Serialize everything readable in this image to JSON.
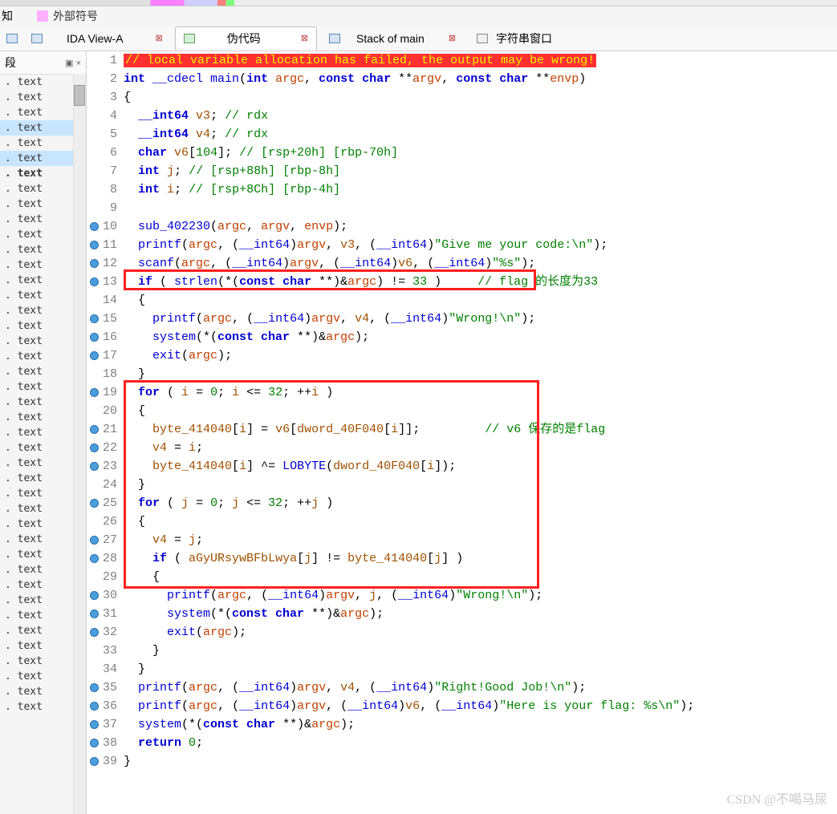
{
  "header": {
    "know_label": "知",
    "ext_symbol": "外部符号"
  },
  "tabs": [
    {
      "label": "IDA View-A",
      "icon": "blue",
      "closeable": true,
      "active": false
    },
    {
      "label": "伪代码",
      "icon": "green",
      "closeable": true,
      "active": true
    },
    {
      "label": "Stack of main",
      "icon": "blue",
      "closeable": true,
      "active": false
    },
    {
      "label": "字符串窗口",
      "icon": "text",
      "closeable": false,
      "active": false
    }
  ],
  "sidebar": {
    "title": "段",
    "items": [
      {
        "t": ". text"
      },
      {
        "t": ". text"
      },
      {
        "t": ". text"
      },
      {
        "t": ". text",
        "hl": true
      },
      {
        "t": ". text"
      },
      {
        "t": ". text",
        "hl": true
      },
      {
        "t": ". text",
        "bold": true
      },
      {
        "t": ". text"
      },
      {
        "t": ". text"
      },
      {
        "t": ". text"
      },
      {
        "t": ". text"
      },
      {
        "t": ". text"
      },
      {
        "t": ". text"
      },
      {
        "t": ". text"
      },
      {
        "t": ". text"
      },
      {
        "t": ". text"
      },
      {
        "t": ". text"
      },
      {
        "t": ". text"
      },
      {
        "t": ". text"
      },
      {
        "t": ". text"
      },
      {
        "t": ". text"
      },
      {
        "t": ". text"
      },
      {
        "t": ". text"
      },
      {
        "t": ". text"
      },
      {
        "t": ". text"
      },
      {
        "t": ". text"
      },
      {
        "t": ". text"
      },
      {
        "t": ". text"
      },
      {
        "t": ". text"
      },
      {
        "t": ". text"
      },
      {
        "t": ". text"
      },
      {
        "t": ". text"
      },
      {
        "t": ". text"
      },
      {
        "t": ". text"
      },
      {
        "t": ". text"
      },
      {
        "t": ". text"
      },
      {
        "t": ". text"
      },
      {
        "t": ". text"
      },
      {
        "t": ". text"
      },
      {
        "t": ". text"
      },
      {
        "t": ". text"
      },
      {
        "t": ". text"
      }
    ]
  },
  "code": {
    "lines": [
      {
        "n": 1,
        "html": "<span class='err-bg'>// local variable allocation has failed, the output may be wrong!</span>"
      },
      {
        "n": 2,
        "html": "<span class='kw'>int</span> <span class='fn'>__cdecl main</span>(<span class='kw'>int</span> <span class='var'>argc</span>, <span class='kw'>const char</span> **<span class='var'>argv</span>, <span class='kw'>const char</span> **<span class='var'>envp</span>)"
      },
      {
        "n": 3,
        "html": "{"
      },
      {
        "n": 4,
        "html": "  <span class='kw'>__int64</span> <span class='var2'>v3</span>; <span class='cmt'>// rdx</span>"
      },
      {
        "n": 5,
        "html": "  <span class='kw'>__int64</span> <span class='var2'>v4</span>; <span class='cmt'>// rdx</span>"
      },
      {
        "n": 6,
        "html": "  <span class='kw'>char</span> <span class='var2'>v6</span>[<span class='num'>104</span>]; <span class='cmt'>// [rsp+20h] [rbp-70h]</span>"
      },
      {
        "n": 7,
        "html": "  <span class='kw'>int</span> <span class='var2'>j</span>; <span class='cmt'>// [rsp+88h] [rbp-8h]</span>"
      },
      {
        "n": 8,
        "html": "  <span class='kw'>int</span> <span class='var2'>i</span>; <span class='cmt'>// [rsp+8Ch] [rbp-4h]</span>"
      },
      {
        "n": 9,
        "html": ""
      },
      {
        "n": 10,
        "bp": true,
        "html": "  <span class='fn'>sub_402230</span>(<span class='var'>argc</span>, <span class='var'>argv</span>, <span class='var'>envp</span>);"
      },
      {
        "n": 11,
        "bp": true,
        "html": "  <span class='fn'>printf</span>(<span class='var'>argc</span>, (<span class='cast'>__int64</span>)<span class='var'>argv</span>, <span class='var2'>v3</span>, (<span class='cast'>__int64</span>)<span class='str'>\"Give me your code:\\n\"</span>);"
      },
      {
        "n": 12,
        "bp": true,
        "html": "  <span class='fn'>scanf</span>(<span class='var'>argc</span>, (<span class='cast'>__int64</span>)<span class='var'>argv</span>, (<span class='cast'>__int64</span>)<span class='var2'>v6</span>, (<span class='cast'>__int64</span>)<span class='str'>\"%s\"</span>);"
      },
      {
        "n": 13,
        "bp": true,
        "html": "  <span class='kw'>if</span> ( <span class='fn'>strlen</span>(*(<span class='kw'>const char</span> **)&<span class='var'>argc</span>) != <span class='num'>33</span> )     <span class='cmt'>// flag 的长度为33</span>"
      },
      {
        "n": 14,
        "html": "  {"
      },
      {
        "n": 15,
        "bp": true,
        "html": "    <span class='fn'>printf</span>(<span class='var'>argc</span>, (<span class='cast'>__int64</span>)<span class='var'>argv</span>, <span class='var2'>v4</span>, (<span class='cast'>__int64</span>)<span class='str'>\"Wrong!\\n\"</span>);"
      },
      {
        "n": 16,
        "bp": true,
        "html": "    <span class='fn'>system</span>(*(<span class='kw'>const char</span> **)&<span class='var'>argc</span>);"
      },
      {
        "n": 17,
        "bp": true,
        "html": "    <span class='fn'>exit</span>(<span class='var'>argc</span>);"
      },
      {
        "n": 18,
        "html": "  }"
      },
      {
        "n": 19,
        "bp": true,
        "html": "  <span class='kw'>for</span> ( <span class='var2'>i</span> = <span class='num'>0</span>; <span class='var2'>i</span> &lt;= <span class='num'>32</span>; ++<span class='var2'>i</span> )"
      },
      {
        "n": 20,
        "html": "  {"
      },
      {
        "n": 21,
        "bp": true,
        "html": "    <span class='var2'>byte_414040</span>[<span class='var2'>i</span>] = <span class='var2'>v6</span>[<span class='var2'>dword_40F040</span>[<span class='var2'>i</span>]];         <span class='cmt'>// v6 保存的是flag</span>"
      },
      {
        "n": 22,
        "bp": true,
        "html": "    <span class='var2'>v4</span> = <span class='var2'>i</span>;"
      },
      {
        "n": 23,
        "bp": true,
        "html": "    <span class='var2'>byte_414040</span>[<span class='var2'>i</span>] ^= <span class='fn'>LOBYTE</span>(<span class='var2'>dword_40F040</span>[<span class='var2'>i</span>]);"
      },
      {
        "n": 24,
        "html": "  }"
      },
      {
        "n": 25,
        "bp": true,
        "html": "  <span class='kw'>for</span> ( <span class='var2'>j</span> = <span class='num'>0</span>; <span class='var2'>j</span> &lt;= <span class='num'>32</span>; ++<span class='var2'>j</span> )"
      },
      {
        "n": 26,
        "html": "  {"
      },
      {
        "n": 27,
        "bp": true,
        "html": "    <span class='var2'>v4</span> = <span class='var2'>j</span>;"
      },
      {
        "n": 28,
        "bp": true,
        "html": "    <span class='kw'>if</span> ( <span class='var2'>aGyURsywBFbLwya</span>[<span class='var2'>j</span>] != <span class='var2'>byte_414040</span>[<span class='var2'>j</span>] )"
      },
      {
        "n": 29,
        "html": "    {"
      },
      {
        "n": 30,
        "bp": true,
        "html": "      <span class='fn'>printf</span>(<span class='var'>argc</span>, (<span class='cast'>__int64</span>)<span class='var'>argv</span>, <span class='var2'>j</span>, (<span class='cast'>__int64</span>)<span class='str'>\"Wrong!\\n\"</span>);"
      },
      {
        "n": 31,
        "bp": true,
        "html": "      <span class='fn'>system</span>(*(<span class='kw'>const char</span> **)&<span class='var'>argc</span>);"
      },
      {
        "n": 32,
        "bp": true,
        "html": "      <span class='fn'>exit</span>(<span class='var'>argc</span>);"
      },
      {
        "n": 33,
        "html": "    }"
      },
      {
        "n": 34,
        "html": "  }"
      },
      {
        "n": 35,
        "bp": true,
        "html": "  <span class='fn'>printf</span>(<span class='var'>argc</span>, (<span class='cast'>__int64</span>)<span class='var'>argv</span>, <span class='var2'>v4</span>, (<span class='cast'>__int64</span>)<span class='str'>\"Right!Good Job!\\n\"</span>);"
      },
      {
        "n": 36,
        "bp": true,
        "html": "  <span class='fn'>printf</span>(<span class='var'>argc</span>, (<span class='cast'>__int64</span>)<span class='var'>argv</span>, (<span class='cast'>__int64</span>)<span class='var2'>v6</span>, (<span class='cast'>__int64</span>)<span class='str'>\"Here is your flag: %s\\n\"</span>);"
      },
      {
        "n": 37,
        "bp": true,
        "html": "  <span class='fn'>system</span>(*(<span class='kw'>const char</span> **)&<span class='var'>argc</span>);"
      },
      {
        "n": 38,
        "bp": true,
        "html": "  <span class='kw'>return</span> <span class='num'>0</span>;"
      },
      {
        "n": 39,
        "bp": true,
        "html": "}"
      }
    ]
  },
  "watermark": "CSDN @不喝马尿"
}
